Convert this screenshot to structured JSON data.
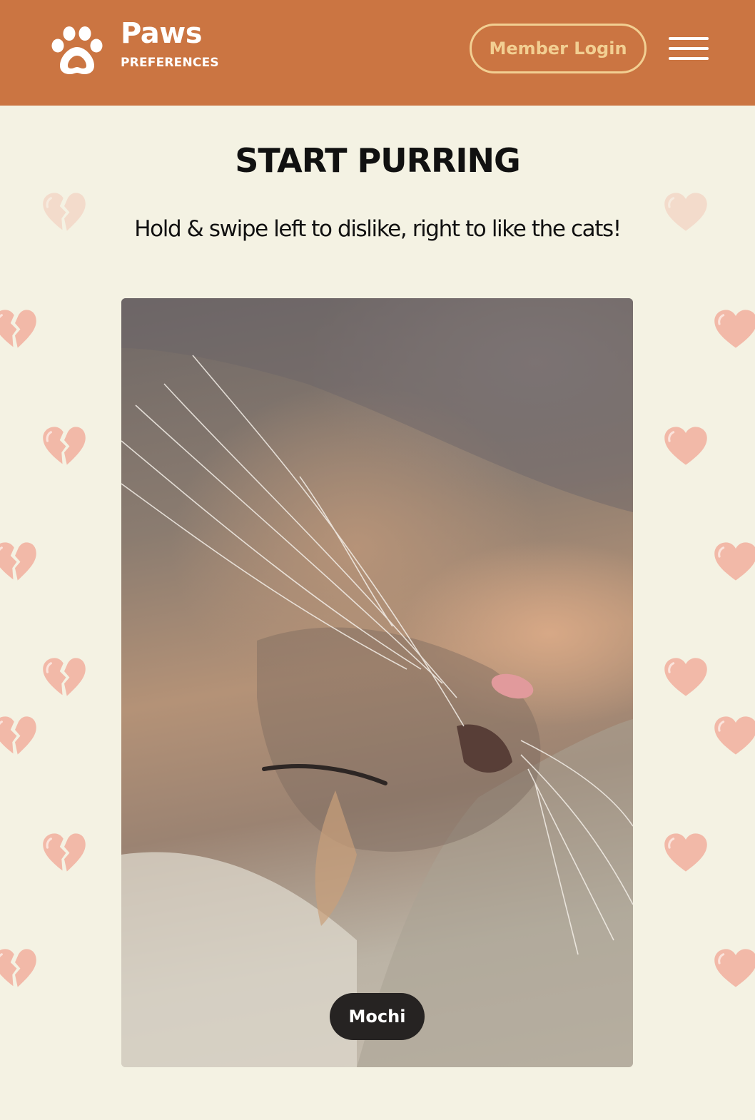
{
  "header": {
    "logo_icon": "paw-icon",
    "brand_name": "Paws",
    "brand_sub": "PREFERENCES",
    "login_label": "Member Login",
    "menu_icon": "hamburger-menu-icon"
  },
  "main": {
    "title": "START PURRING",
    "subtitle": "Hold & swipe left to dislike, right to like the cats!"
  },
  "card": {
    "image": "sleeping-cat-photo",
    "cat_name": "Mochi"
  },
  "decorations": {
    "left_icon": "broken-heart-icon",
    "right_icon": "heart-icon",
    "heart_color": "#f2b9a8"
  },
  "colors": {
    "header_bg": "#cb7542",
    "page_bg": "#f4f2e3",
    "login_accent": "#f2cf92",
    "pill_bg": "#262322"
  }
}
